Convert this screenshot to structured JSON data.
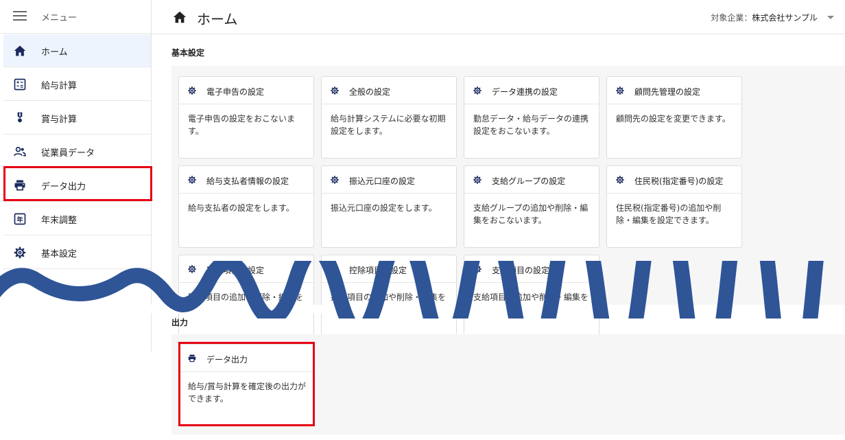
{
  "sidebar": {
    "menu_label": "メニュー",
    "items": [
      {
        "label": "ホーム",
        "icon": "home-icon"
      },
      {
        "label": "給与計算",
        "icon": "calculator-icon"
      },
      {
        "label": "賞与計算",
        "icon": "award-icon"
      },
      {
        "label": "従業員データ",
        "icon": "people-icon"
      },
      {
        "label": "データ出力",
        "icon": "printer-icon"
      },
      {
        "label": "年末調整",
        "icon": "calendar-year-icon"
      },
      {
        "label": "基本設定",
        "icon": "gear-icon"
      }
    ]
  },
  "header": {
    "title": "ホーム",
    "company_prefix": "対象企業：",
    "company_name": "株式会社サンプル"
  },
  "basic_settings": {
    "title": "基本設定",
    "cards": [
      {
        "title": "電子申告の設定",
        "desc": "電子申告の設定をおこないます。"
      },
      {
        "title": "全般の設定",
        "desc": "給与計算システムに必要な初期設定をします。"
      },
      {
        "title": "データ連携の設定",
        "desc": "勤怠データ・給与データの連携設定をおこないます。"
      },
      {
        "title": "顧問先管理の設定",
        "desc": "顧問先の設定を変更できます。"
      },
      {
        "title": "給与支払者情報の設定",
        "desc": "給与支払者の設定をします。"
      },
      {
        "title": "振込元口座の設定",
        "desc": "振込元口座の設定をします。"
      },
      {
        "title": "支給グループの設定",
        "desc": "支給グループの追加や削除・編集をおこないます。"
      },
      {
        "title": "住民税(指定番号)の設定",
        "desc": "住民税(指定番号)の追加や削除・編集を設定できます。"
      },
      {
        "title": "勤怠項目の設定",
        "desc": "勤怠項目の追加や削除・編集を設定できます。"
      },
      {
        "title": "控除項目の設定",
        "desc": "控除項目の追加や削除・編集を設定できます。"
      },
      {
        "title": "支給項目の設定",
        "desc": "支給項目の追加や削除・編集を設定できます。"
      }
    ]
  },
  "output": {
    "title": "出力",
    "cards": [
      {
        "title": "データ出力",
        "desc": "給与/賞与計算を確定後の出力ができます。"
      }
    ]
  },
  "colors": {
    "icon_navy": "#1a2a5e",
    "highlight": "#e60012",
    "wave": "#2f5597"
  }
}
